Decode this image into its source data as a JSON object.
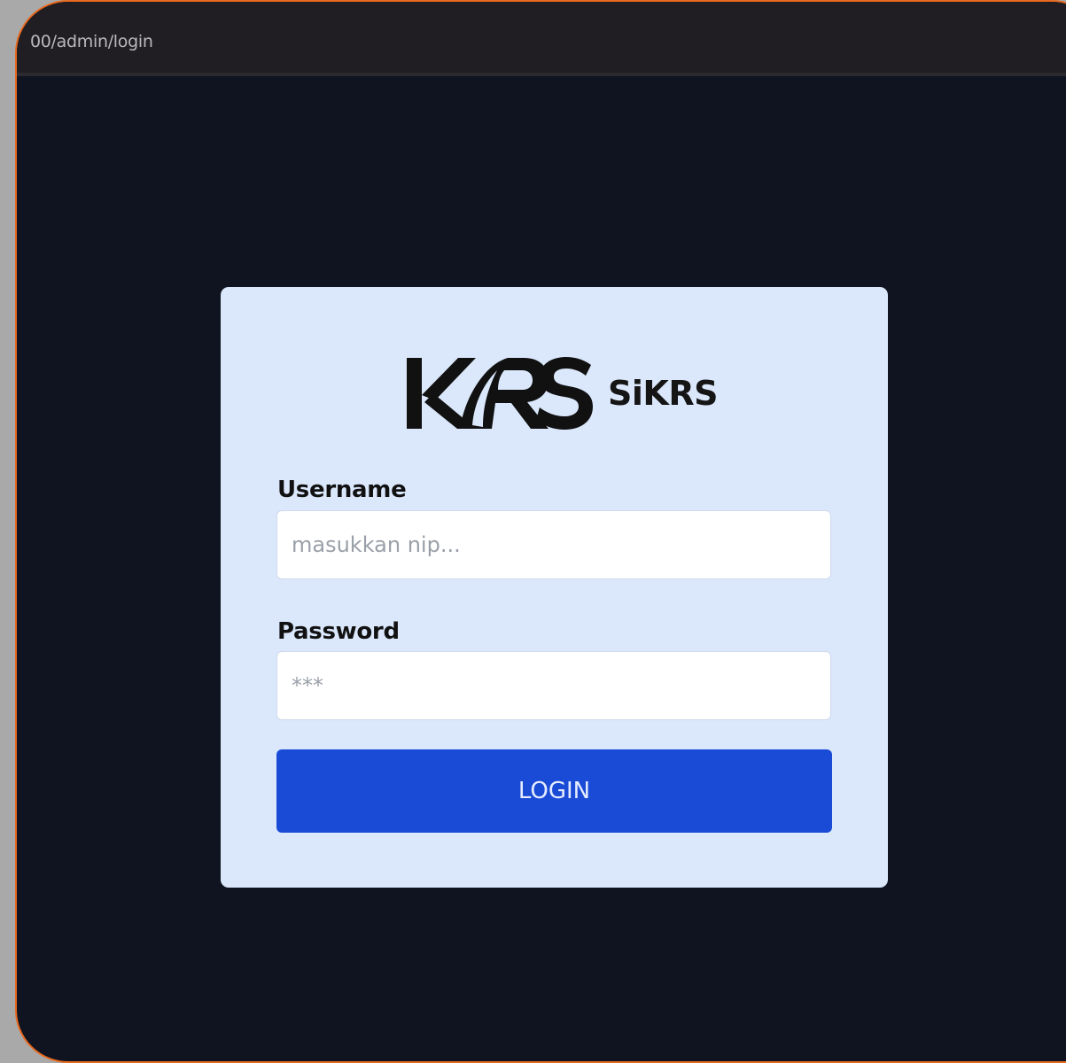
{
  "browser": {
    "url": "00/admin/login"
  },
  "login": {
    "logo_mark": "KRS",
    "app_name": "SiKRS",
    "username_label": "Username",
    "username_placeholder": "masukkan nip...",
    "password_label": "Password",
    "password_placeholder": "***",
    "login_button": "LOGIN"
  },
  "colors": {
    "background": "#0f1420",
    "card": "#dbe8fc",
    "button": "#1a4bd6",
    "frame_border": "#e8691f"
  }
}
